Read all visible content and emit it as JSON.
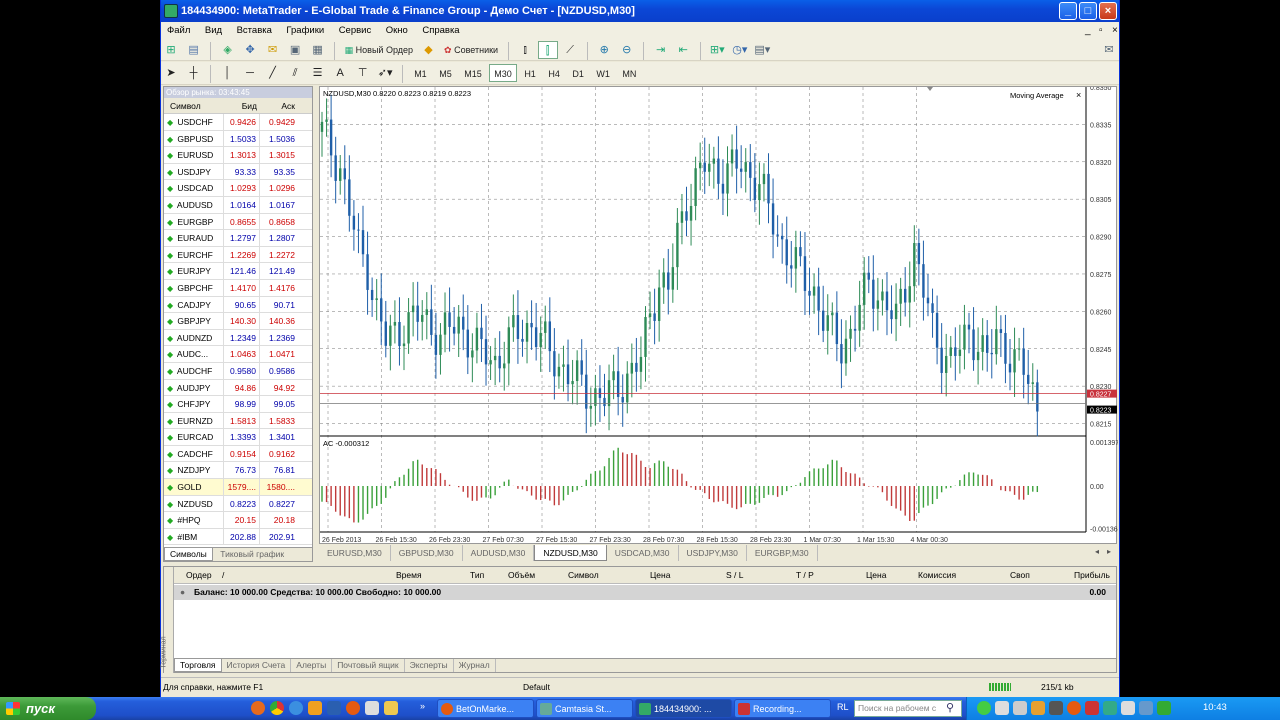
{
  "window": {
    "title": "184434900: MetaTrader - E-Global Trade & Finance Group - Демо Счет - [NZDUSD,M30]",
    "minimize": "_",
    "maximize": "□",
    "close": "×"
  },
  "menu": [
    "Файл",
    "Вид",
    "Вставка",
    "Графики",
    "Сервис",
    "Окно",
    "Справка"
  ],
  "toolbar": {
    "new_order": "Новый Ордер",
    "experts": "Советники",
    "timeframes": [
      "M1",
      "M5",
      "M15",
      "M30",
      "H1",
      "H4",
      "D1",
      "W1",
      "MN"
    ],
    "active_timeframe": "M30",
    "text_tool": "A"
  },
  "market_watch": {
    "title": "Обзор рынка: 03:43:45",
    "col_symbol": "Символ",
    "col_bid": "Бид",
    "col_ask": "Аск",
    "rows": [
      {
        "symbol": "USDCHF",
        "bid": "0.9426",
        "ask": "0.9429"
      },
      {
        "symbol": "GBPUSD",
        "bid": "1.5033",
        "ask": "1.5036"
      },
      {
        "symbol": "EURUSD",
        "bid": "1.3013",
        "ask": "1.3015"
      },
      {
        "symbol": "USDJPY",
        "bid": "93.33",
        "ask": "93.35"
      },
      {
        "symbol": "USDCAD",
        "bid": "1.0293",
        "ask": "1.0296"
      },
      {
        "symbol": "AUDUSD",
        "bid": "1.0164",
        "ask": "1.0167"
      },
      {
        "symbol": "EURGBP",
        "bid": "0.8655",
        "ask": "0.8658"
      },
      {
        "symbol": "EURAUD",
        "bid": "1.2797",
        "ask": "1.2807"
      },
      {
        "symbol": "EURCHF",
        "bid": "1.2269",
        "ask": "1.2272"
      },
      {
        "symbol": "EURJPY",
        "bid": "121.46",
        "ask": "121.49"
      },
      {
        "symbol": "GBPCHF",
        "bid": "1.4170",
        "ask": "1.4176"
      },
      {
        "symbol": "CADJPY",
        "bid": "90.65",
        "ask": "90.71"
      },
      {
        "symbol": "GBPJPY",
        "bid": "140.30",
        "ask": "140.36"
      },
      {
        "symbol": "AUDNZD",
        "bid": "1.2349",
        "ask": "1.2369"
      },
      {
        "symbol": "AUDC...",
        "bid": "1.0463",
        "ask": "1.0471"
      },
      {
        "symbol": "AUDCHF",
        "bid": "0.9580",
        "ask": "0.9586"
      },
      {
        "symbol": "AUDJPY",
        "bid": "94.86",
        "ask": "94.92"
      },
      {
        "symbol": "CHFJPY",
        "bid": "98.99",
        "ask": "99.05"
      },
      {
        "symbol": "EURNZD",
        "bid": "1.5813",
        "ask": "1.5833"
      },
      {
        "symbol": "EURCAD",
        "bid": "1.3393",
        "ask": "1.3401"
      },
      {
        "symbol": "CADCHF",
        "bid": "0.9154",
        "ask": "0.9162"
      },
      {
        "symbol": "NZDJPY",
        "bid": "76.73",
        "ask": "76.81"
      },
      {
        "symbol": "GOLD",
        "bid": "1579....",
        "ask": "1580...."
      },
      {
        "symbol": "NZDUSD",
        "bid": "0.8223",
        "ask": "0.8227"
      },
      {
        "symbol": "#HPQ",
        "bid": "20.15",
        "ask": "20.18"
      },
      {
        "symbol": "#IBM",
        "bid": "202.88",
        "ask": "202.91"
      }
    ],
    "tabs": [
      "Символы",
      "Тиковый график"
    ]
  },
  "chart": {
    "header": "NZDUSD,M30  0.8220 0.8223 0.8219 0.8223",
    "indicator_label": "Moving Average",
    "indicator_close": "×",
    "sub_label": "AC -0.000312",
    "price_ticks": [
      "0.8350",
      "0.8335",
      "0.8320",
      "0.8305",
      "0.8290",
      "0.8275",
      "0.8260",
      "0.8245",
      "0.8230",
      "0.8215"
    ],
    "price_tag_red": "0.8227",
    "price_tag_black": "0.8223",
    "sub_ticks": [
      "0.001397",
      "0.00",
      "-0.00136"
    ],
    "time_labels": [
      "26 Feb 2013",
      "26 Feb 15:30",
      "26 Feb 23:30",
      "27 Feb 07:30",
      "27 Feb 15:30",
      "27 Feb 23:30",
      "28 Feb 07:30",
      "28 Feb 15:30",
      "28 Feb 23:30",
      "1 Mar 07:30",
      "1 Mar 15:30",
      "4 Mar 00:30"
    ],
    "colors": {
      "up": "#2e8b57",
      "down": "#1f5fa8",
      "bid_line": "#c8323c",
      "ac_up": "#3aa03a",
      "ac_down": "#c03a3a"
    }
  },
  "chart_data": {
    "type": "candlestick",
    "symbol": "NZDUSD",
    "timeframe": "M30",
    "ylim": [
      0.821,
      0.835
    ],
    "close_path": [
      [
        0,
        0.8332
      ],
      [
        2,
        0.8325
      ],
      [
        4,
        0.8318
      ],
      [
        6,
        0.83
      ],
      [
        8,
        0.8285
      ],
      [
        10,
        0.8278
      ],
      [
        12,
        0.826
      ],
      [
        14,
        0.8248
      ],
      [
        18,
        0.8255
      ],
      [
        22,
        0.8258
      ],
      [
        26,
        0.825
      ],
      [
        30,
        0.8255
      ],
      [
        34,
        0.8245
      ],
      [
        38,
        0.824
      ],
      [
        42,
        0.825
      ],
      [
        46,
        0.8255
      ],
      [
        50,
        0.8243
      ],
      [
        54,
        0.8235
      ],
      [
        58,
        0.8228
      ],
      [
        62,
        0.8225
      ],
      [
        66,
        0.8232
      ],
      [
        70,
        0.824
      ],
      [
        72,
        0.826
      ],
      [
        74,
        0.8272
      ],
      [
        76,
        0.8268
      ],
      [
        78,
        0.829
      ],
      [
        80,
        0.8305
      ],
      [
        82,
        0.8312
      ],
      [
        84,
        0.8318
      ],
      [
        88,
        0.8316
      ],
      [
        92,
        0.8318
      ],
      [
        96,
        0.8312
      ],
      [
        98,
        0.83
      ],
      [
        100,
        0.829
      ],
      [
        102,
        0.8285
      ],
      [
        104,
        0.8278
      ],
      [
        106,
        0.8272
      ],
      [
        108,
        0.8268
      ],
      [
        110,
        0.8258
      ],
      [
        112,
        0.825
      ],
      [
        114,
        0.8246
      ],
      [
        116,
        0.8252
      ],
      [
        118,
        0.8262
      ],
      [
        120,
        0.827
      ],
      [
        122,
        0.8268
      ],
      [
        124,
        0.8262
      ],
      [
        126,
        0.8256
      ],
      [
        128,
        0.827
      ],
      [
        130,
        0.8285
      ],
      [
        132,
        0.8268
      ],
      [
        134,
        0.8252
      ],
      [
        136,
        0.8245
      ],
      [
        138,
        0.824
      ],
      [
        140,
        0.8245
      ],
      [
        142,
        0.8252
      ],
      [
        144,
        0.8248
      ],
      [
        146,
        0.824
      ],
      [
        148,
        0.825
      ],
      [
        150,
        0.8246
      ],
      [
        152,
        0.824
      ],
      [
        154,
        0.8236
      ],
      [
        156,
        0.8228
      ],
      [
        157,
        0.8223
      ]
    ],
    "ac_values": [
      -0.0005,
      -0.0008,
      -0.0012,
      -0.0009,
      -0.0004,
      0.0003,
      0.0008,
      0.0006,
      0.0002,
      -0.0002,
      -0.0005,
      -0.0003,
      0.0002,
      -0.0002,
      -0.0004,
      -0.0006,
      -0.0003,
      0.0002,
      0.0006,
      0.0012,
      0.001,
      0.0006,
      0.0008,
      0.0004,
      -0.0001,
      -0.0004,
      -0.0006,
      -0.0007,
      -0.0005,
      -0.0003,
      -0.0002,
      0.0003,
      0.0006,
      0.0008,
      0.0004,
      0.0001,
      -0.0002,
      -0.0008,
      -0.0011,
      -0.0006,
      -0.0002,
      0.0002,
      0.0005,
      0.0002,
      -0.0002,
      -0.0004,
      -0.0002
    ]
  },
  "chart_tabs": [
    "EURUSD,M30",
    "GBPUSD,M30",
    "AUDUSD,M30",
    "NZDUSD,M30",
    "USDCAD,M30",
    "USDJPY,M30",
    "EURGBP,M30"
  ],
  "active_chart_tab": "NZDUSD,M30",
  "terminal": {
    "side_label": "Терминал",
    "columns": [
      "Ордер",
      "/",
      "Время",
      "Тип",
      "Объём",
      "Символ",
      "Цена",
      "S / L",
      "T / P",
      "Цена",
      "Комиссия",
      "Своп",
      "Прибыль"
    ],
    "balance_line": "Баланс: 10 000.00  Средства: 10 000.00  Свободно: 10 000.00",
    "balance_profit": "0.00",
    "tabs": [
      "Торговля",
      "История Счета",
      "Алерты",
      "Почтовый ящик",
      "Эксперты",
      "Журнал"
    ]
  },
  "status_bar": {
    "help": "Для справки, нажмите F1",
    "profile": "Default",
    "traffic": "215/1 kb"
  },
  "taskbar": {
    "start": "пуск",
    "tasks": [
      "BetOnMarke...",
      "Camtasia St...",
      "184434900: ...",
      "Recording..."
    ],
    "lang": "RL",
    "search_placeholder": "Поиск на рабочем с",
    "clock": "10:43"
  }
}
